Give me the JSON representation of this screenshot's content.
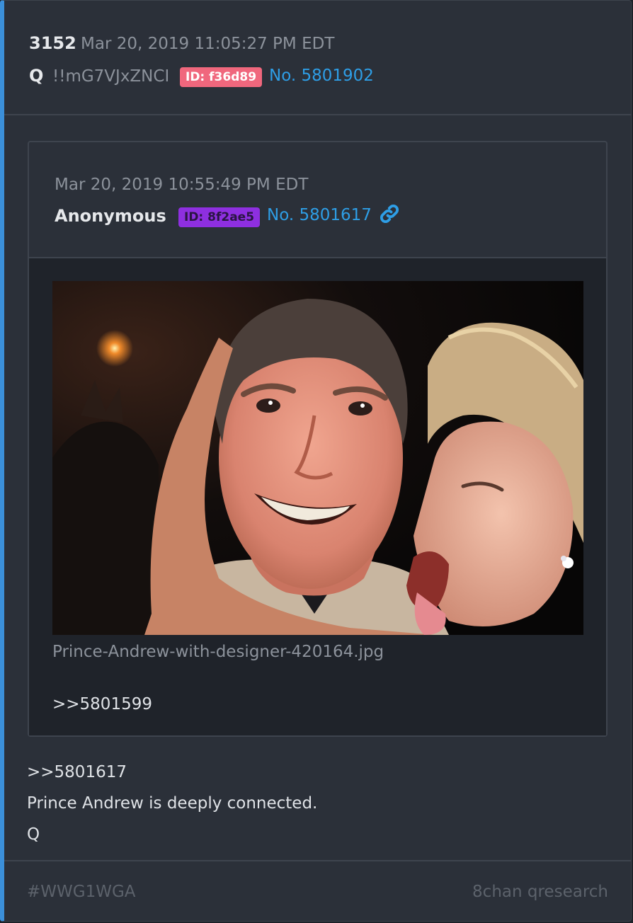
{
  "post": {
    "number": "3152",
    "date": "Mar 20, 2019 11:05:27 PM EDT",
    "author": "Q",
    "tripcode": "!!mG7VJxZNCI",
    "id_badge": "ID: f36d89",
    "post_no": "No. 5801902",
    "body": {
      "reply_ref": ">>5801617",
      "text": "Prince Andrew is deeply connected.",
      "signature": "Q"
    }
  },
  "quoted_post": {
    "date": "Mar 20, 2019 10:55:49 PM EDT",
    "author": "Anonymous",
    "id_badge": "ID: 8f2ae5",
    "post_no": "No. 5801617",
    "link_icon": "link-icon",
    "image_filename": "Prince-Andrew-with-designer-420164.jpg",
    "reply_ref": ">>5801599"
  },
  "footer": {
    "hashtag": "#WWG1WGA",
    "site": "8chan qresearch"
  },
  "colors": {
    "accent": "#3b8fd9",
    "link": "#2e9ee6",
    "q_id_badge": "#f0677d",
    "anon_id_badge": "#8e2fe0"
  }
}
